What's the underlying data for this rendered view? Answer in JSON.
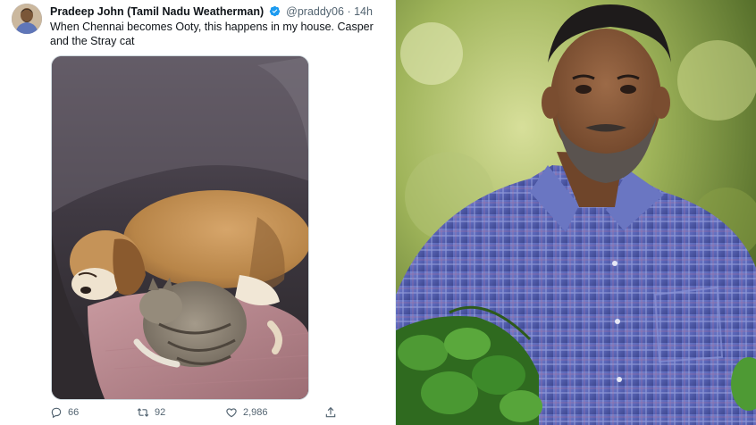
{
  "tweet": {
    "display_name": "Pradeep John (Tamil Nadu Weatherman)",
    "handle": "@praddy06",
    "separator": "·",
    "time": "14h",
    "text": "When Chennai becomes Ooty, this happens in my house. Casper and the Stray cat",
    "actions": {
      "replies": "66",
      "retweets": "92",
      "likes": "2,986"
    }
  },
  "icons": {
    "verified": "verified-badge-icon",
    "reply": "reply-icon",
    "retweet": "retweet-icon",
    "like": "heart-icon",
    "share": "share-icon"
  },
  "colors": {
    "verified_blue": "#1d9bf0",
    "text_primary": "#0f1419",
    "text_secondary": "#536471",
    "shirt_blue": "#5a66b8",
    "leaf_green": "#3d8a2a"
  }
}
